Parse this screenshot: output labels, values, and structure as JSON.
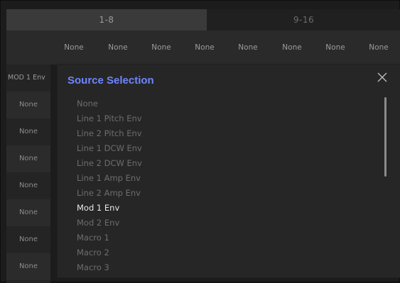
{
  "tabs": [
    {
      "label": "1-8",
      "active": true
    },
    {
      "label": "9-16",
      "active": false
    }
  ],
  "column_headers": [
    "None",
    "None",
    "None",
    "None",
    "None",
    "None",
    "None",
    "None"
  ],
  "row_labels": [
    "MOD 1 Env",
    "None",
    "None",
    "None",
    "None",
    "None",
    "None",
    "None"
  ],
  "modal": {
    "title": "Source Selection",
    "close_icon": "close-icon",
    "items": [
      "None",
      "Line 1 Pitch Env",
      "Line 2 Pitch Env",
      "Line 1 DCW Env",
      "Line 2 DCW Env",
      "Line 1 Amp Env",
      "Line 2 Amp Env",
      "Mod 1 Env",
      "Mod 2 Env",
      "Macro 1",
      "Macro 2",
      "Macro 3"
    ],
    "selected_item": "Mod 1 Env"
  },
  "colors": {
    "accent": "#6f86ff",
    "selected_text": "#e8e8e8",
    "muted_text": "#6d6d6d"
  }
}
